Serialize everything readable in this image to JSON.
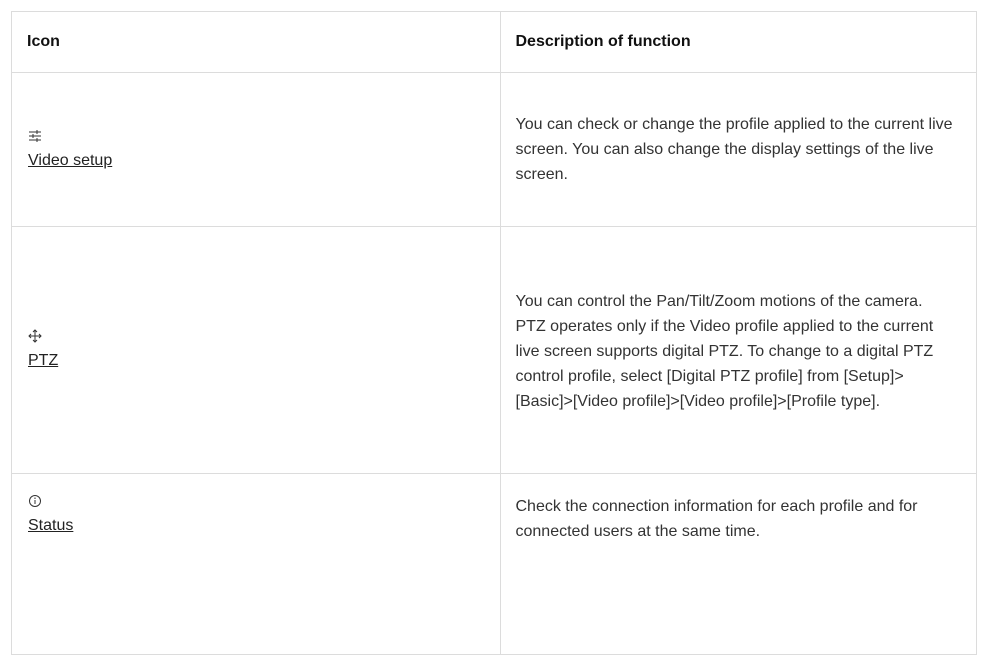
{
  "table": {
    "headers": {
      "icon": "Icon",
      "description": "Description of function"
    },
    "rows": [
      {
        "icon": "sliders-icon",
        "label": "Video setup",
        "description": [
          "You can check or change the profile applied to the current live screen. You can also change the display settings of the live screen."
        ]
      },
      {
        "icon": "move-arrows-icon",
        "label": "PTZ",
        "description": [
          "You can control the Pan/Tilt/Zoom motions of the camera.",
          "PTZ operates only if the Video profile applied to the current live screen supports digital PTZ. To change to a digital PTZ control profile, select [Digital PTZ profile] from [Setup]>[Basic]>[Video profile]>[Video profile]>[Profile type]."
        ]
      },
      {
        "icon": "info-circle-icon",
        "label": "Status",
        "description": [
          "Check the connection information for each profile and for connected users at the same time."
        ]
      }
    ]
  }
}
